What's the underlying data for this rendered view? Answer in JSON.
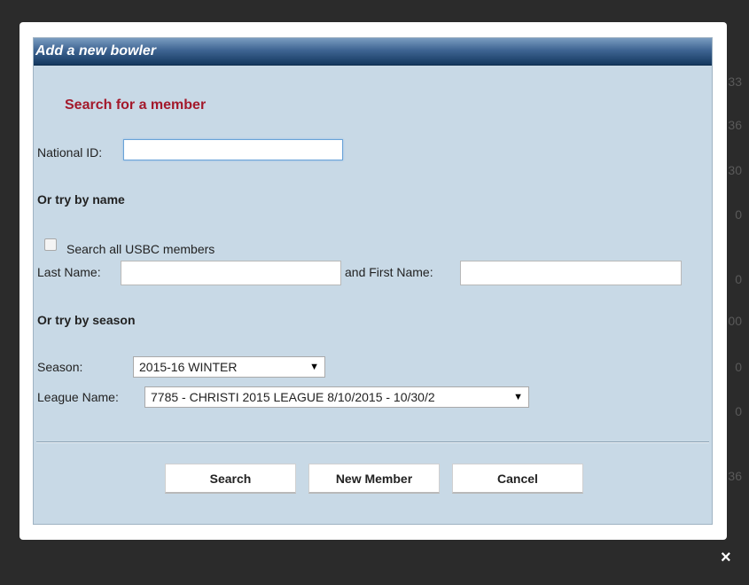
{
  "dialog": {
    "title": "Add a new bowler",
    "search_heading": "Search for a member",
    "national_id_label": "National ID:",
    "national_id_value": "",
    "by_name_heading": "Or try by name",
    "search_all_label": "Search all USBC members",
    "search_all_checked": false,
    "last_name_label": "Last Name:",
    "last_name_value": "",
    "first_name_label": "and First Name:",
    "first_name_value": "",
    "by_season_heading": "Or try by season",
    "season_label": "Season:",
    "season_selected": "2015-16 WINTER",
    "league_label": "League Name:",
    "league_selected": "7785 - CHRISTI 2015 LEAGUE 8/10/2015 - 10/30/2",
    "buttons": {
      "search": "Search",
      "new_member": "New Member",
      "cancel": "Cancel"
    }
  },
  "close_glyph": "×",
  "background_digits": [
    "33",
    "36",
    "30",
    "0",
    "0",
    "00",
    "0",
    "0",
    "36"
  ],
  "colors": {
    "title_bar": "#3f6593",
    "dialog_bg": "#c8d9e6",
    "heading_red": "#a3192b",
    "overlay": "#2b2b2b"
  }
}
